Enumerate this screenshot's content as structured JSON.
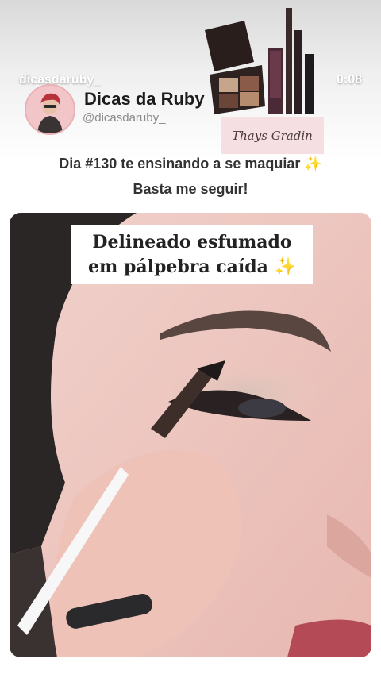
{
  "status": {
    "username": "dicasdaruby_",
    "time": "0:08"
  },
  "profile": {
    "name": "Dicas da Ruby",
    "handle": "@dicasdaruby_"
  },
  "watermark": "Thays Gradin",
  "caption": {
    "line1": "Dia #130 te ensinando a se maquiar ✨",
    "line2": "Basta me seguir!"
  },
  "video": {
    "title_line1": "Delineado esfumado",
    "title_line2": "em pálpebra caída ✨"
  },
  "colors": {
    "accent_pink": "#f3c7c9",
    "frame_border": "#f5c9cd"
  }
}
